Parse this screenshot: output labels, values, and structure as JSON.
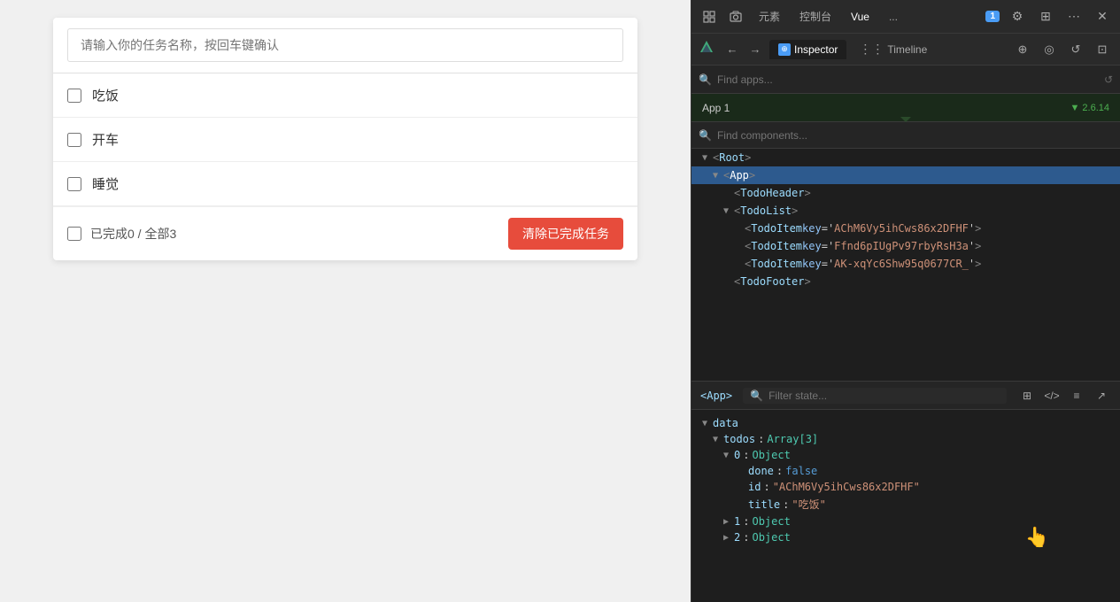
{
  "todo": {
    "input_placeholder": "请输入你的任务名称，按回车键确认",
    "items": [
      {
        "label": "吃饭",
        "done": false
      },
      {
        "label": "开车",
        "done": false
      },
      {
        "label": "睡觉",
        "done": false
      }
    ],
    "footer_status": "已完成0 / 全部3",
    "clear_button": "清除已完成任务"
  },
  "devtools": {
    "tabs": [
      {
        "label": "元素",
        "active": false
      },
      {
        "label": "控制台",
        "active": false
      },
      {
        "label": "Vue",
        "active": true
      },
      {
        "label": "...",
        "active": false
      }
    ],
    "badge": "1",
    "toolbar2": {
      "inspector_label": "Inspector",
      "timeline_label": "Timeline"
    },
    "find_apps_placeholder": "Find apps...",
    "app_banner": "App 1",
    "app_version": "▼ 2.6.14",
    "find_components_placeholder": "Find components...",
    "tree": {
      "items": [
        {
          "indent": 0,
          "arrow": "▼",
          "tag": "<Root>",
          "attr": "",
          "attr_val": ""
        },
        {
          "indent": 1,
          "arrow": "▼",
          "tag": "<App>",
          "attr": "",
          "attr_val": ""
        },
        {
          "indent": 2,
          "arrow": "",
          "tag": "<TodoHeader>",
          "attr": "",
          "attr_val": ""
        },
        {
          "indent": 2,
          "arrow": "▼",
          "tag": "<TodoList>",
          "attr": "",
          "attr_val": ""
        },
        {
          "indent": 3,
          "arrow": "",
          "tag": "<TodoItem ",
          "attr": "key='AChM6Vy5ihCws86x2DFHF'",
          "attr_val": ""
        },
        {
          "indent": 3,
          "arrow": "",
          "tag": "<TodoItem ",
          "attr": "key='Ffnd6pIUgPv97rbyRsH3a'",
          "attr_val": ""
        },
        {
          "indent": 3,
          "arrow": "",
          "tag": "<TodoItem ",
          "attr": "key='AK-xqYc6Shw95q0677CR_'",
          "attr_val": ""
        },
        {
          "indent": 2,
          "arrow": "",
          "tag": "<TodoFooter>",
          "attr": "",
          "attr_val": ""
        }
      ]
    },
    "bottom": {
      "app_tag": "<App>",
      "filter_placeholder": "Filter state...",
      "state_label": "data",
      "todos_label": "todos",
      "todos_type": "Array[3]",
      "obj0_label": "0",
      "obj0_type": "Object",
      "done_key": "done",
      "done_val": "false",
      "id_key": "id",
      "id_val": "\"AChM6Vy5ihCws86x2DFHF\"",
      "title_key": "title",
      "title_val": "\"吃饭\"",
      "obj1_label": "1",
      "obj1_type": "Object",
      "obj2_label": "2",
      "obj2_type": "Object"
    }
  }
}
